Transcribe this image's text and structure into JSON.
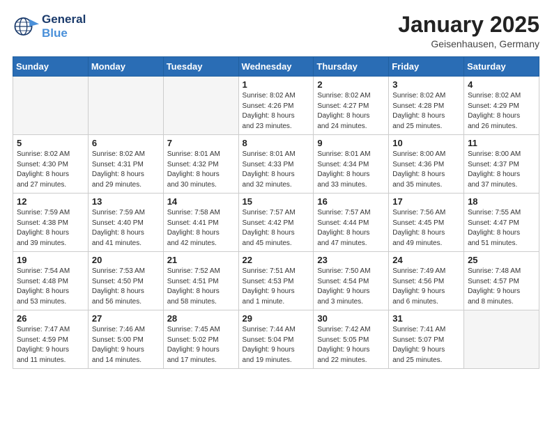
{
  "header": {
    "logo_line1": "General",
    "logo_line2": "Blue",
    "month": "January 2025",
    "location": "Geisenhausen, Germany"
  },
  "weekdays": [
    "Sunday",
    "Monday",
    "Tuesday",
    "Wednesday",
    "Thursday",
    "Friday",
    "Saturday"
  ],
  "weeks": [
    [
      {
        "day": "",
        "empty": true
      },
      {
        "day": "",
        "empty": true
      },
      {
        "day": "",
        "empty": true
      },
      {
        "day": "1",
        "sunrise": "8:02 AM",
        "sunset": "4:26 PM",
        "daylight": "8 hours and 23 minutes."
      },
      {
        "day": "2",
        "sunrise": "8:02 AM",
        "sunset": "4:27 PM",
        "daylight": "8 hours and 24 minutes."
      },
      {
        "day": "3",
        "sunrise": "8:02 AM",
        "sunset": "4:28 PM",
        "daylight": "8 hours and 25 minutes."
      },
      {
        "day": "4",
        "sunrise": "8:02 AM",
        "sunset": "4:29 PM",
        "daylight": "8 hours and 26 minutes."
      }
    ],
    [
      {
        "day": "5",
        "sunrise": "8:02 AM",
        "sunset": "4:30 PM",
        "daylight": "8 hours and 27 minutes."
      },
      {
        "day": "6",
        "sunrise": "8:02 AM",
        "sunset": "4:31 PM",
        "daylight": "8 hours and 29 minutes."
      },
      {
        "day": "7",
        "sunrise": "8:01 AM",
        "sunset": "4:32 PM",
        "daylight": "8 hours and 30 minutes."
      },
      {
        "day": "8",
        "sunrise": "8:01 AM",
        "sunset": "4:33 PM",
        "daylight": "8 hours and 32 minutes."
      },
      {
        "day": "9",
        "sunrise": "8:01 AM",
        "sunset": "4:34 PM",
        "daylight": "8 hours and 33 minutes."
      },
      {
        "day": "10",
        "sunrise": "8:00 AM",
        "sunset": "4:36 PM",
        "daylight": "8 hours and 35 minutes."
      },
      {
        "day": "11",
        "sunrise": "8:00 AM",
        "sunset": "4:37 PM",
        "daylight": "8 hours and 37 minutes."
      }
    ],
    [
      {
        "day": "12",
        "sunrise": "7:59 AM",
        "sunset": "4:38 PM",
        "daylight": "8 hours and 39 minutes."
      },
      {
        "day": "13",
        "sunrise": "7:59 AM",
        "sunset": "4:40 PM",
        "daylight": "8 hours and 41 minutes."
      },
      {
        "day": "14",
        "sunrise": "7:58 AM",
        "sunset": "4:41 PM",
        "daylight": "8 hours and 42 minutes."
      },
      {
        "day": "15",
        "sunrise": "7:57 AM",
        "sunset": "4:42 PM",
        "daylight": "8 hours and 45 minutes."
      },
      {
        "day": "16",
        "sunrise": "7:57 AM",
        "sunset": "4:44 PM",
        "daylight": "8 hours and 47 minutes."
      },
      {
        "day": "17",
        "sunrise": "7:56 AM",
        "sunset": "4:45 PM",
        "daylight": "8 hours and 49 minutes."
      },
      {
        "day": "18",
        "sunrise": "7:55 AM",
        "sunset": "4:47 PM",
        "daylight": "8 hours and 51 minutes."
      }
    ],
    [
      {
        "day": "19",
        "sunrise": "7:54 AM",
        "sunset": "4:48 PM",
        "daylight": "8 hours and 53 minutes."
      },
      {
        "day": "20",
        "sunrise": "7:53 AM",
        "sunset": "4:50 PM",
        "daylight": "8 hours and 56 minutes."
      },
      {
        "day": "21",
        "sunrise": "7:52 AM",
        "sunset": "4:51 PM",
        "daylight": "8 hours and 58 minutes."
      },
      {
        "day": "22",
        "sunrise": "7:51 AM",
        "sunset": "4:53 PM",
        "daylight": "9 hours and 1 minute."
      },
      {
        "day": "23",
        "sunrise": "7:50 AM",
        "sunset": "4:54 PM",
        "daylight": "9 hours and 3 minutes."
      },
      {
        "day": "24",
        "sunrise": "7:49 AM",
        "sunset": "4:56 PM",
        "daylight": "9 hours and 6 minutes."
      },
      {
        "day": "25",
        "sunrise": "7:48 AM",
        "sunset": "4:57 PM",
        "daylight": "9 hours and 8 minutes."
      }
    ],
    [
      {
        "day": "26",
        "sunrise": "7:47 AM",
        "sunset": "4:59 PM",
        "daylight": "9 hours and 11 minutes."
      },
      {
        "day": "27",
        "sunrise": "7:46 AM",
        "sunset": "5:00 PM",
        "daylight": "9 hours and 14 minutes."
      },
      {
        "day": "28",
        "sunrise": "7:45 AM",
        "sunset": "5:02 PM",
        "daylight": "9 hours and 17 minutes."
      },
      {
        "day": "29",
        "sunrise": "7:44 AM",
        "sunset": "5:04 PM",
        "daylight": "9 hours and 19 minutes."
      },
      {
        "day": "30",
        "sunrise": "7:42 AM",
        "sunset": "5:05 PM",
        "daylight": "9 hours and 22 minutes."
      },
      {
        "day": "31",
        "sunrise": "7:41 AM",
        "sunset": "5:07 PM",
        "daylight": "9 hours and 25 minutes."
      },
      {
        "day": "",
        "empty": true
      }
    ]
  ],
  "labels": {
    "sunrise": "Sunrise:",
    "sunset": "Sunset:",
    "daylight": "Daylight hours"
  }
}
